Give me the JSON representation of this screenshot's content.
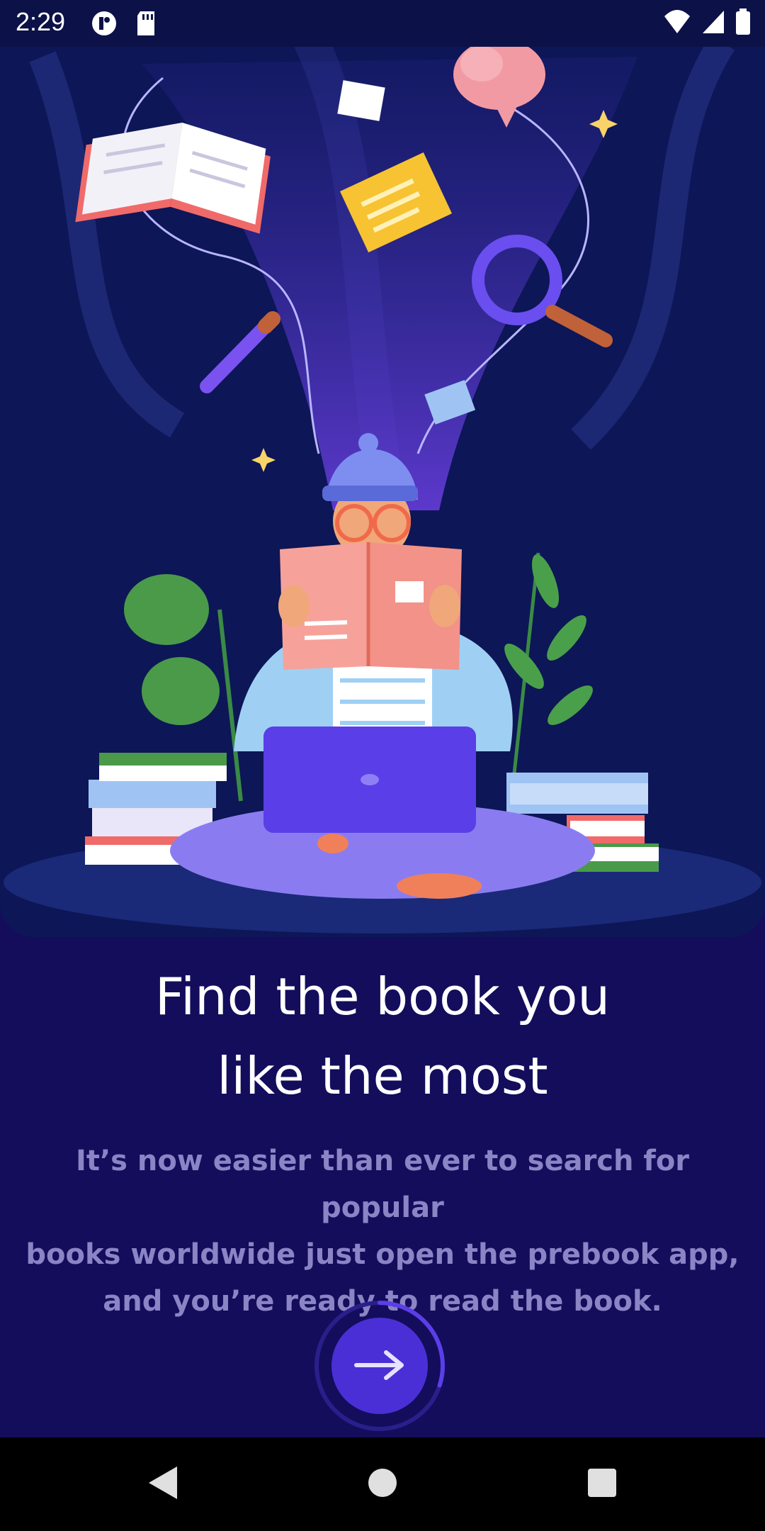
{
  "status_bar": {
    "time": "2:29",
    "icons": [
      "app-notification-icon",
      "sd-card-icon",
      "wifi-icon",
      "signal-icon",
      "battery-icon"
    ]
  },
  "onboarding": {
    "illustration": "person-reading-book-illustration",
    "title_line1": "Find the book you",
    "title_line2": "like the most",
    "description_line1": "It’s now easier than ever to search for popular",
    "description_line2": "books worldwide just open the prebook app,",
    "description_line3": "and you’re ready to read the book.",
    "next_icon": "arrow-right-icon",
    "progress": 0.3
  },
  "nav_bar": {
    "icons": [
      "back-icon",
      "home-icon",
      "recents-icon"
    ]
  },
  "colors": {
    "background": "#130d5c",
    "hero_background": "#0d1656",
    "accent": "#4a2fd6",
    "body_text": "#8b84c5"
  }
}
